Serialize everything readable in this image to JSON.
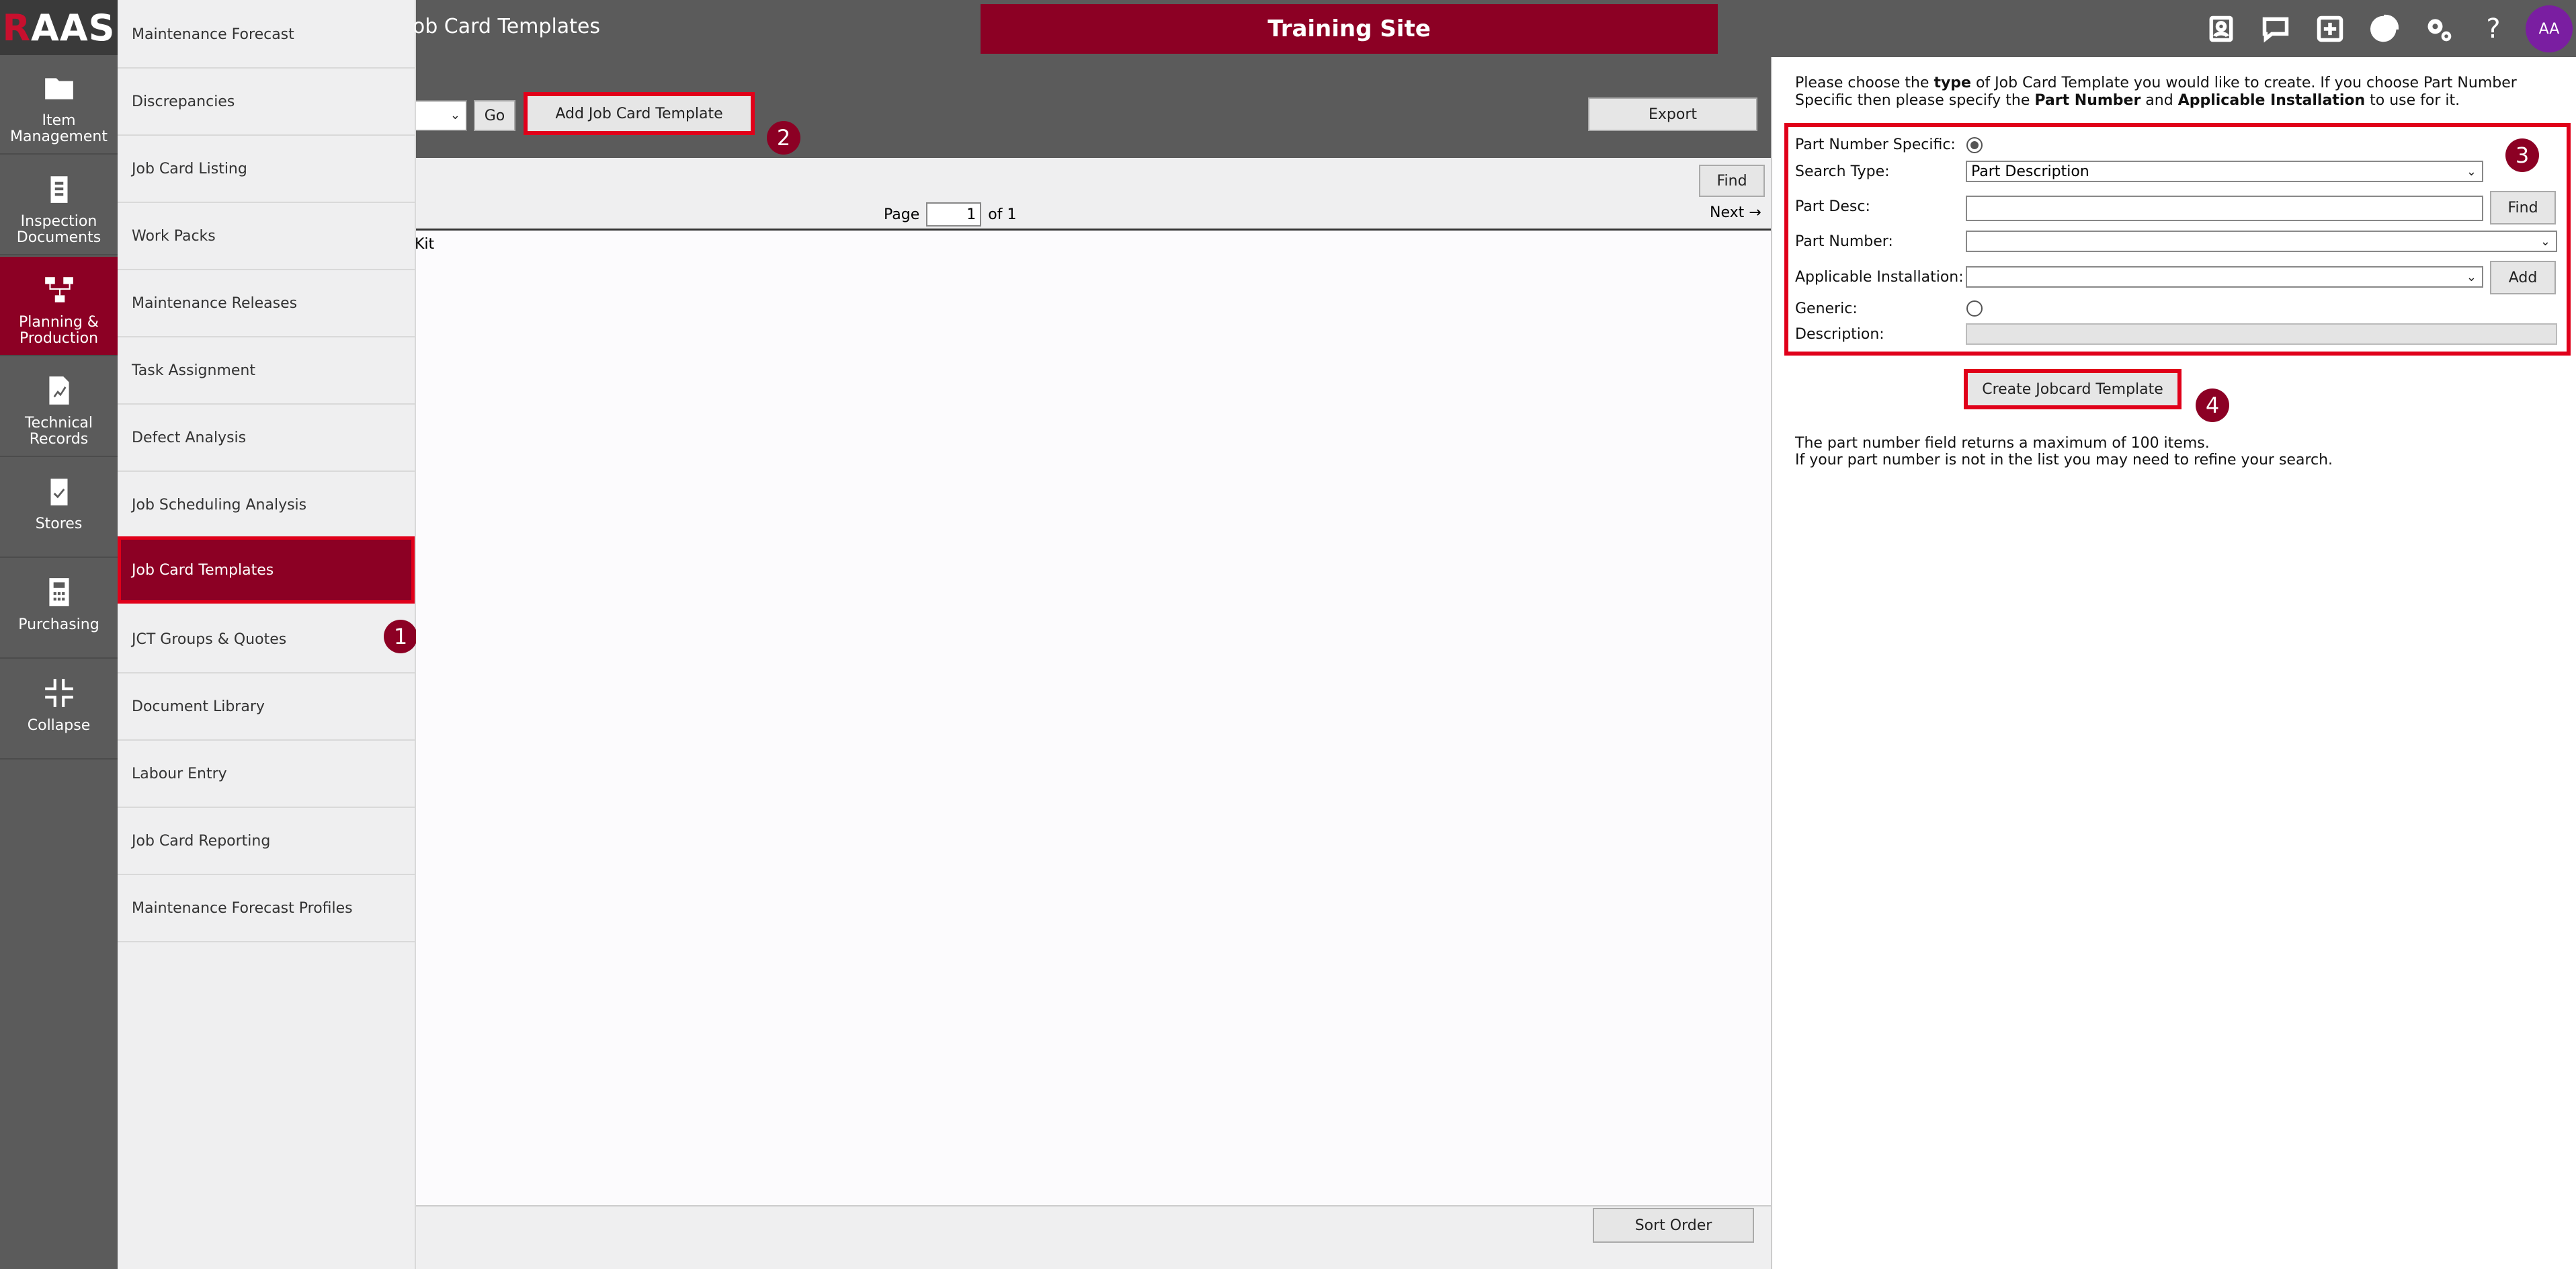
{
  "app": {
    "logo_prefix": "R",
    "logo_rest": "AAS",
    "page_title": "Job Card Templates",
    "site_banner": "Training Site",
    "avatar": "AA"
  },
  "rail": [
    {
      "label": "Item Management",
      "icon": "folder-icon"
    },
    {
      "label": "Inspection Documents",
      "icon": "clipboard-icon"
    },
    {
      "label": "Planning & Production",
      "icon": "workflow-icon",
      "active": true
    },
    {
      "label": "Technical Records",
      "icon": "chart-document-icon"
    },
    {
      "label": "Stores",
      "icon": "clipboard-check-icon"
    },
    {
      "label": "Purchasing",
      "icon": "calculator-icon"
    },
    {
      "label": "Collapse",
      "icon": "collapse-icon"
    }
  ],
  "submenu": [
    "Maintenance Forecast",
    "Discrepancies",
    "Job Card Listing",
    "Work Packs",
    "Maintenance Releases",
    "Task Assignment",
    "Defect Analysis",
    "Job Scheduling Analysis",
    "Job Card Templates",
    "JCT Groups & Quotes",
    "Document Library",
    "Labour Entry",
    "Job Card Reporting",
    "Maintenance Forecast Profiles"
  ],
  "toolbar": {
    "go_label": "Go",
    "add_label": "Add Job Card Template",
    "export_label": "Export"
  },
  "list": {
    "find_label": "Find",
    "page_label": "Page",
    "page_value": "1",
    "of_label": "of 1",
    "next_label": "Next →",
    "col_fragment": "Kit",
    "sort_label": "Sort Order"
  },
  "badges": [
    "1",
    "2",
    "3",
    "4"
  ],
  "panel": {
    "intro_1": "Please choose the ",
    "intro_type": "type",
    "intro_2": " of Job Card Template you would like to create. If you choose Part Number",
    "intro_3": "Specific then please specify the ",
    "intro_pn": "Part Number",
    "intro_4": " and ",
    "intro_ai": "Applicable Installation",
    "intro_5": " to use for it.",
    "lbl_pns": "Part Number Specific:",
    "lbl_search_type": "Search Type:",
    "search_type_value": "Part Description",
    "lbl_part_desc": "Part Desc:",
    "find_label": "Find",
    "lbl_part_number": "Part Number:",
    "lbl_app_inst": "Applicable Installation:",
    "add_label": "Add",
    "lbl_generic": "Generic:",
    "lbl_description": "Description:",
    "create_label": "Create Jobcard Template",
    "note_1": "The part number field returns a maximum of 100 items.",
    "note_2": "If your part number is not in the list you may need to refine your search."
  }
}
